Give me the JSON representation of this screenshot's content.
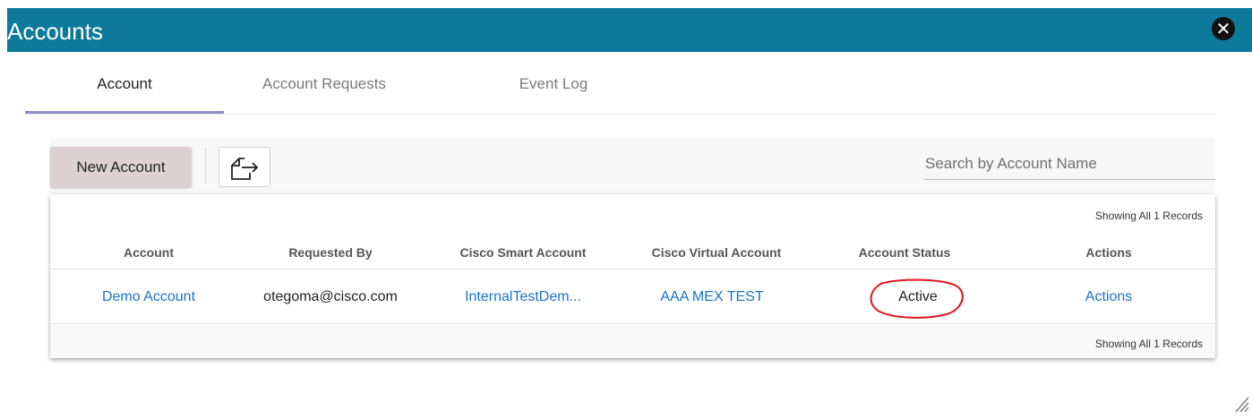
{
  "window": {
    "title": "Accounts",
    "close_icon": "close-icon"
  },
  "tabs": [
    {
      "label": "Account",
      "active": true
    },
    {
      "label": "Account Requests",
      "active": false
    },
    {
      "label": "Event Log",
      "active": false
    }
  ],
  "toolbar": {
    "new_button": "New Account",
    "export_icon": "export-icon",
    "search_placeholder": "Search by Account Name"
  },
  "table": {
    "records_top": "Showing All 1 Records",
    "records_bottom": "Showing All 1 Records",
    "columns": [
      "Account",
      "Requested By",
      "Cisco Smart Account",
      "Cisco Virtual Account",
      "Account Status",
      "Actions"
    ],
    "rows": [
      {
        "account": "Demo Account",
        "requested_by": "otegoma@cisco.com",
        "smart_account": "InternalTestDem...",
        "virtual_account": "AAA MEX TEST",
        "status": "Active",
        "actions": "Actions"
      }
    ]
  },
  "colors": {
    "titlebar": "#0d7a9b",
    "link": "#1a73c4",
    "annotation": "#e0161b",
    "tab_underline": "#8f8fc9"
  }
}
